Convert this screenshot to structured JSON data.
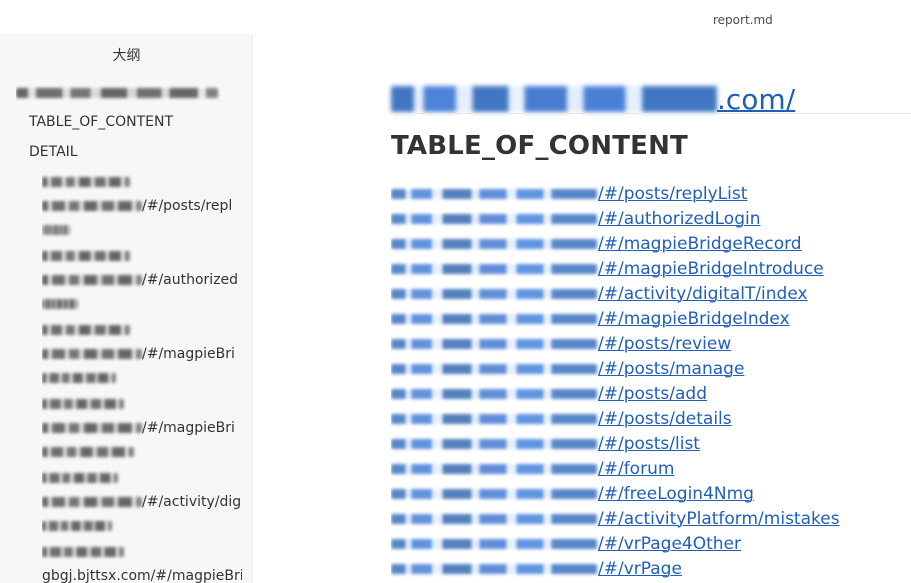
{
  "window": {
    "title": "report.md"
  },
  "sidebar": {
    "header": "大纲",
    "root_item": "https://cxhg-gbgj.bjttsx.com/",
    "items_h2": [
      "TABLE_OF_CONTENT",
      "DETAIL"
    ],
    "items_h3": [
      {
        "line2_suffix": "/#/posts/repl"
      },
      {
        "line2_suffix": "/#/authorized"
      },
      {
        "line2_suffix": "/#/magpieBri"
      },
      {
        "line2_suffix": "/#/magpieBri"
      },
      {
        "line2_suffix": "/#/activity/dig"
      },
      {
        "line2_text": "gbgj.bjttsx.com/#/magpieBri"
      }
    ]
  },
  "main": {
    "title_link_suffix": ".com/",
    "h2": "TABLE_OF_CONTENT",
    "links": [
      "/#/posts/replyList",
      "/#/authorizedLogin",
      "/#/magpieBridgeRecord",
      "/#/magpieBridgeIntroduce",
      "/#/activity/digitalT/index",
      "/#/magpieBridgeIndex",
      "/#/posts/review",
      "/#/posts/manage",
      "/#/posts/add",
      "/#/posts/details",
      "/#/posts/list",
      "/#/forum",
      "/#/freeLogin4Nmg",
      "/#/activityPlatform/mistakes",
      "/#/vrPage4Other",
      "/#/vrPage"
    ]
  },
  "colors": {
    "link": "#1f5fb8",
    "text": "#333333",
    "sidebar_bg": "#f7f7f7"
  }
}
